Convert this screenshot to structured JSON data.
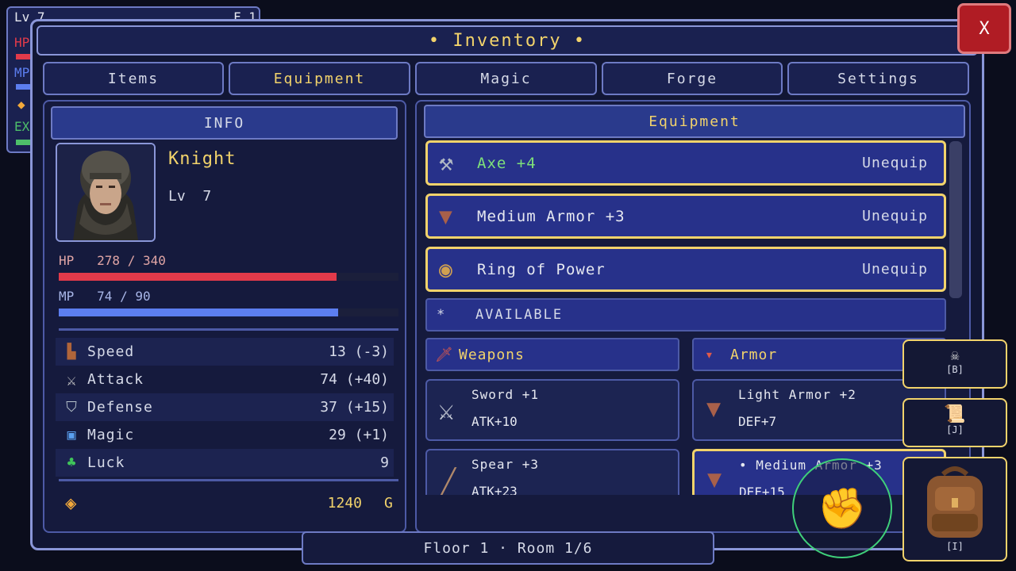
{
  "hud": {
    "level": "Lv 7",
    "floor_short": "F 1",
    "hp_label": "HP",
    "mp_label": "MP",
    "exp_label": "EX"
  },
  "window": {
    "title": "• Inventory •",
    "close_label": "X"
  },
  "tabs": [
    {
      "label": "Items"
    },
    {
      "label": "Equipment"
    },
    {
      "label": "Magic"
    },
    {
      "label": "Forge"
    },
    {
      "label": "Settings"
    }
  ],
  "info": {
    "header": "INFO",
    "name": "Knight",
    "level_text": "Lv  7",
    "hp_text": "HP   278 / 340",
    "hp_fraction": 0.818,
    "mp_text": "MP   74 / 90",
    "mp_fraction": 0.822,
    "stats": [
      {
        "label": "Speed",
        "value": "13 (-3)",
        "icon": "boots-icon"
      },
      {
        "label": "Attack",
        "value": "74 (+40)",
        "icon": "crossed-swords-icon"
      },
      {
        "label": "Defense",
        "value": "37 (+15)",
        "icon": "shield-icon"
      },
      {
        "label": "Magic",
        "value": "29 (+1)",
        "icon": "spellbook-icon"
      },
      {
        "label": "Luck",
        "value": "9",
        "icon": "clover-icon"
      }
    ],
    "gold_amount": "1240",
    "gold_unit": "G"
  },
  "equipment": {
    "header": "Equipment",
    "equipped": [
      {
        "name": "Axe +4",
        "action": "Unequip",
        "icon": "axe-icon"
      },
      {
        "name": "Medium Armor +3",
        "action": "Unequip",
        "icon": "armor-icon"
      },
      {
        "name": "Ring of Power",
        "action": "Unequip",
        "icon": "ring-icon"
      }
    ],
    "available_label": "*   AVAILABLE",
    "weapons_header": "Weapons",
    "armor_header": "Armor",
    "weapons": [
      {
        "name": "Sword +1",
        "stat": "ATK+10"
      },
      {
        "name": "Spear +3",
        "stat": "ATK+23"
      }
    ],
    "armor": [
      {
        "name": "Light Armor +2",
        "stat": "DEF+7"
      },
      {
        "name": "• Medium Armor +3",
        "stat": "DEF+15"
      }
    ]
  },
  "quickslots": [
    {
      "key": "[B]",
      "icon": "bestiary-icon"
    },
    {
      "key": "[J]",
      "icon": "journal-scroll-icon"
    },
    {
      "key": "[I]",
      "icon": "backpack-icon"
    }
  ],
  "footer": {
    "location": "Floor 1 · Room 1/6"
  },
  "colors": {
    "accent": "#f2d36b",
    "hp_bar": "#e23a4a",
    "mp_bar": "#5c7ef0",
    "panel_border": "#6d7ac4",
    "item_border": "#f2d36b",
    "close_button": "#b01c24"
  }
}
